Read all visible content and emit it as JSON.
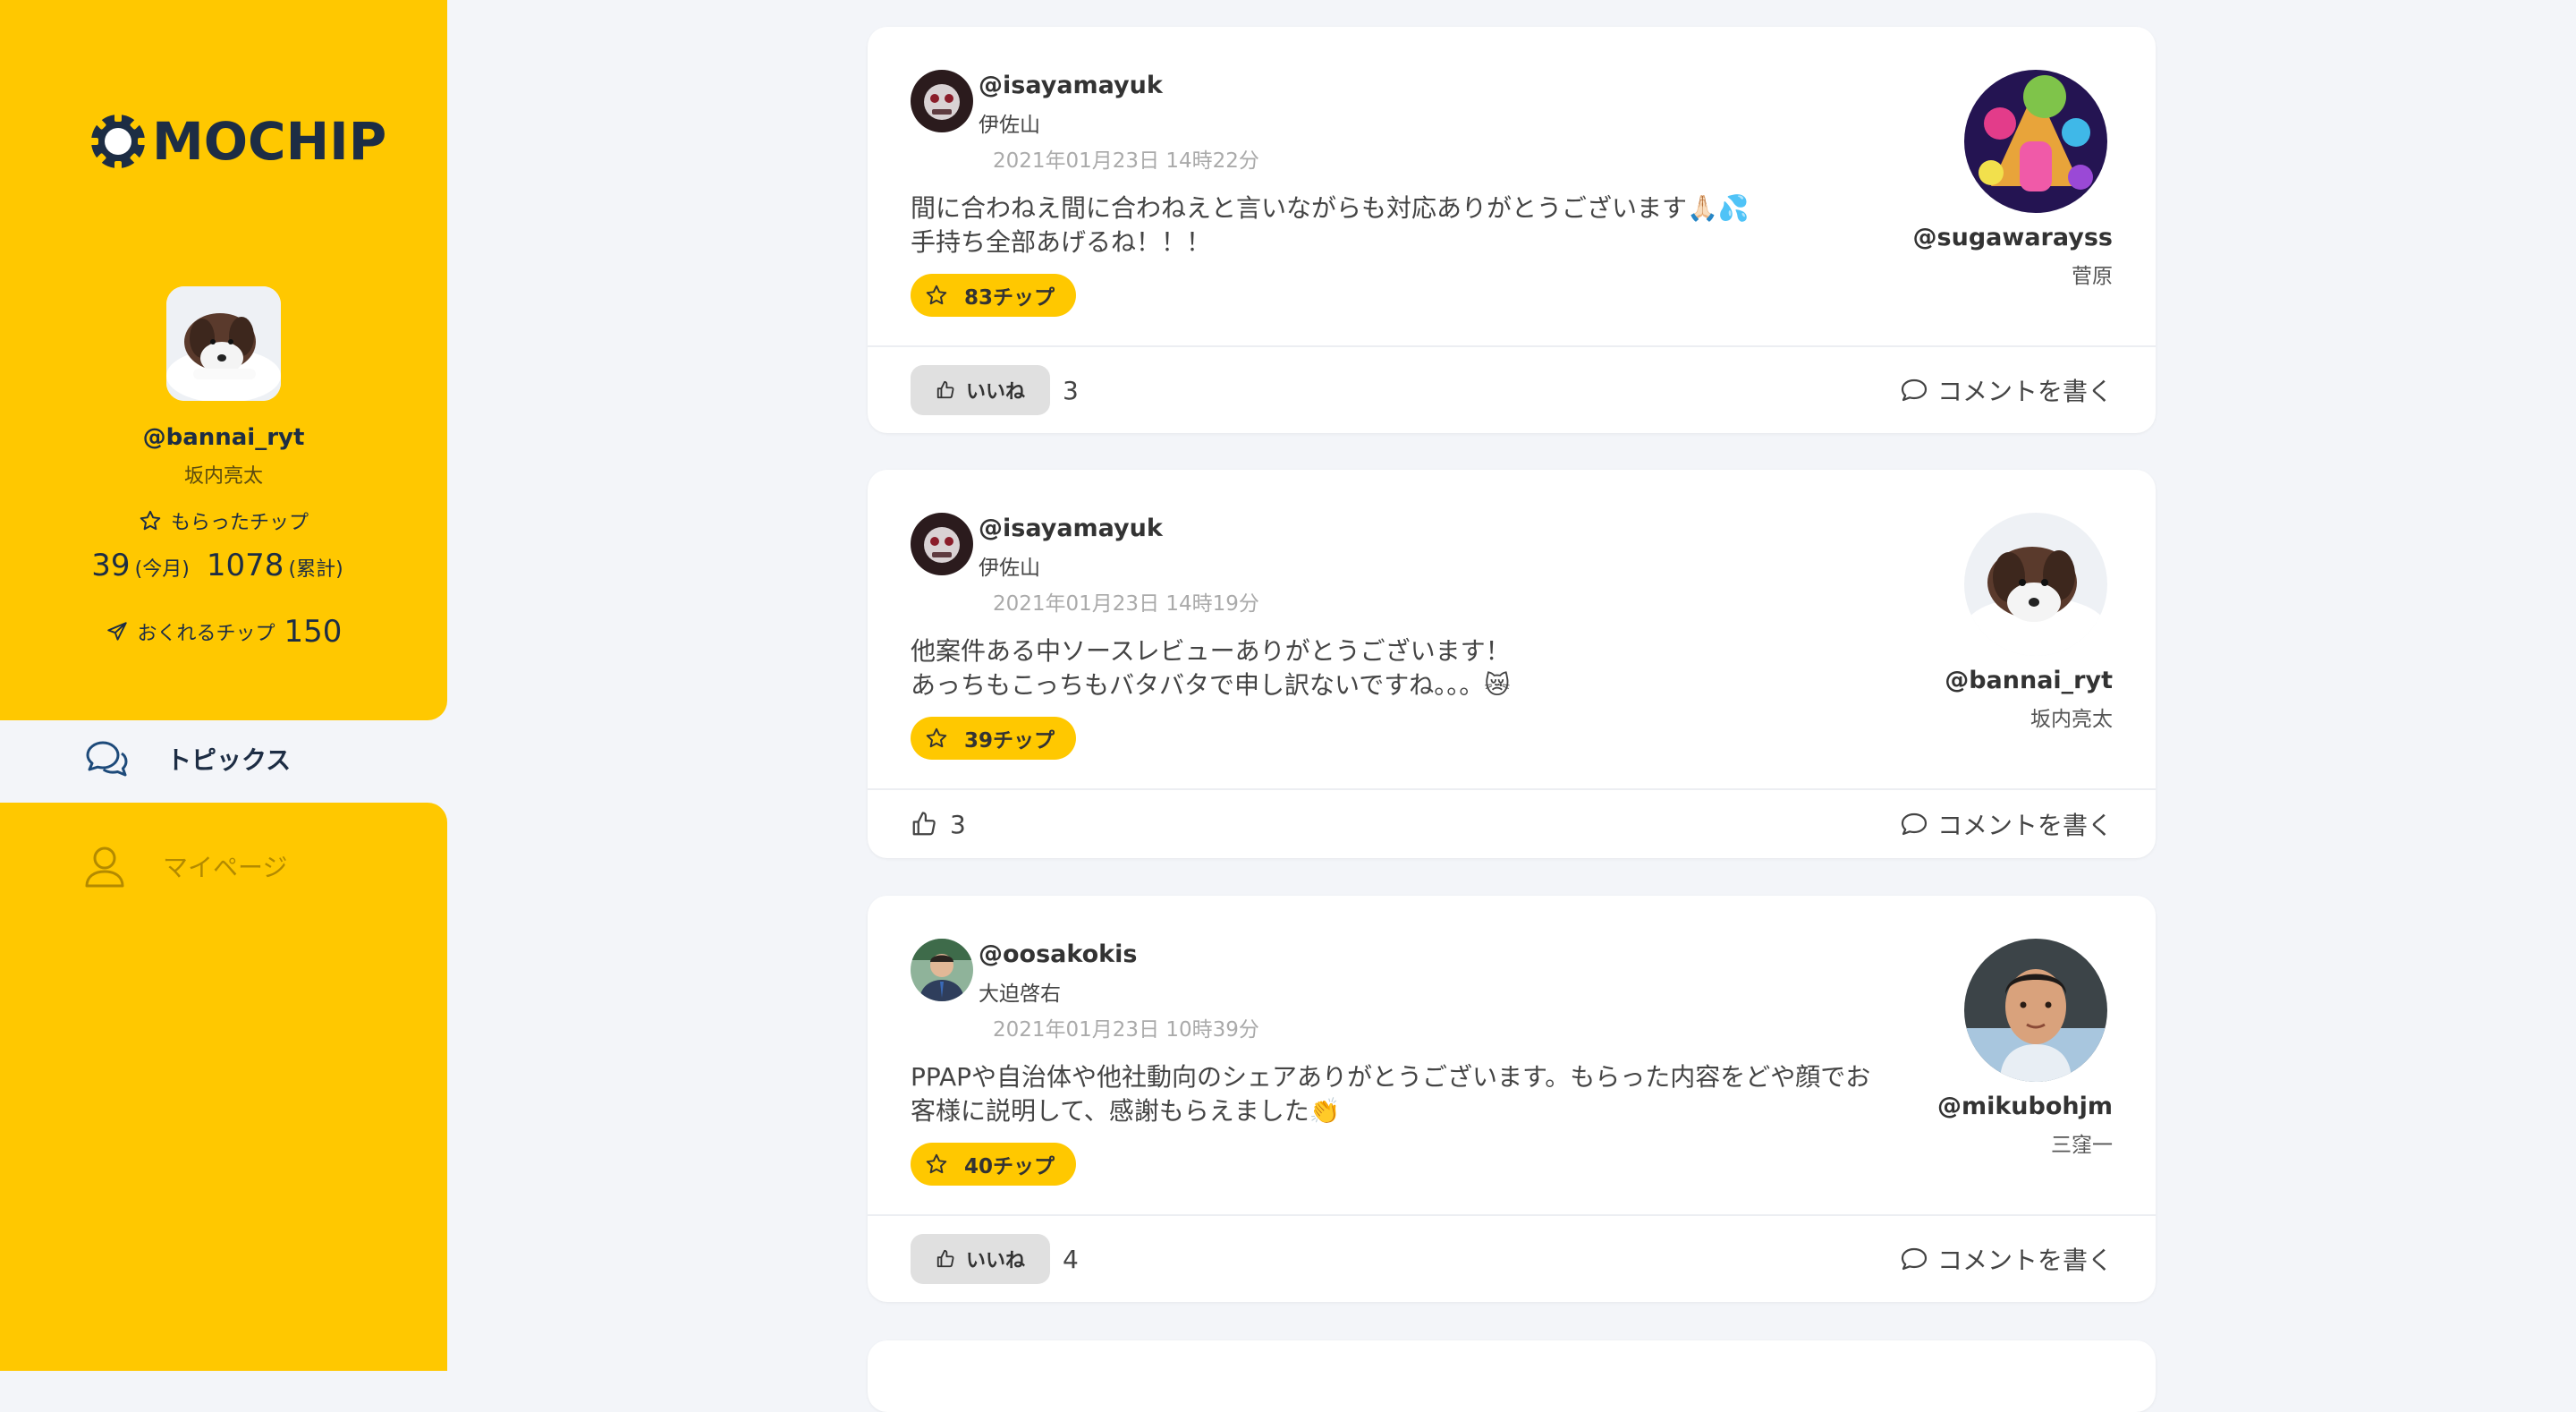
{
  "app": {
    "logo": "MOCHIP"
  },
  "profile": {
    "handle": "@bannai_ryt",
    "name": "坂内亮太",
    "received_label": "もらったチップ",
    "month_value": "39",
    "month_unit": "(今月)",
    "total_value": "1078",
    "total_unit": "(累計)",
    "send_label": "おくれるチップ",
    "send_value": "150"
  },
  "nav": {
    "topics": "トピックス",
    "mypage": "マイページ"
  },
  "posts": [
    {
      "sender_handle": "@isayamayuk",
      "sender_name": "伊佐山",
      "date": "2021年01月23日 14時22分",
      "message_line1": "間に合わねえ間に合わねえと言いながらも対応ありがとうございます🙏🏻💦",
      "message_line2": "手持ち全部あげるね！！！",
      "chips": "83チップ",
      "recipient_handle": "@sugawarayss",
      "recipient_name": "菅原",
      "like_label": "いいね",
      "like_count": "3",
      "comment_label": "コメントを書く"
    },
    {
      "sender_handle": "@isayamayuk",
      "sender_name": "伊佐山",
      "date": "2021年01月23日 14時19分",
      "message_line1": "他案件ある中ソースレビューありがとうございます！",
      "message_line2": "あっちもこっちもバタバタで申し訳ないですね。。。😿",
      "chips": "39チップ",
      "recipient_handle": "@bannai_ryt",
      "recipient_name": "坂内亮太",
      "like_count": "3",
      "comment_label": "コメントを書く"
    },
    {
      "sender_handle": "@oosakokis",
      "sender_name": "大迫啓右",
      "date": "2021年01月23日 10時39分",
      "message_line1": "PPAPや自治体や他社動向のシェアありがとうございます。もらった内容をどや顔でお",
      "message_line2": "客様に説明して、感謝もらえました👏",
      "chips": "40チップ",
      "recipient_handle": "@mikubohjm",
      "recipient_name": "三窪一",
      "like_label": "いいね",
      "like_count": "4",
      "comment_label": "コメントを書く"
    }
  ]
}
